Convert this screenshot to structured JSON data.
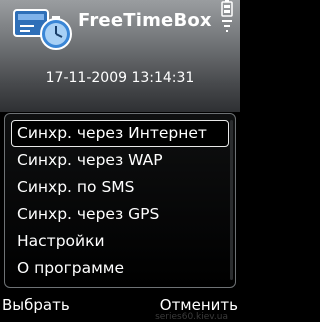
{
  "app": {
    "title": "FreeTimeBox",
    "datetime": "17-11-2009 13:14:31"
  },
  "menu": {
    "items": [
      {
        "label": "Синхр. через Интернет",
        "selected": true
      },
      {
        "label": "Синхр. через WAP",
        "selected": false
      },
      {
        "label": "Синхр. по SMS",
        "selected": false
      },
      {
        "label": "Синхр. через GPS",
        "selected": false
      },
      {
        "label": "Настройки",
        "selected": false
      },
      {
        "label": "О программе",
        "selected": false
      }
    ]
  },
  "softkeys": {
    "left": "Выбрать",
    "right": "Отменить"
  },
  "watermark": "series60.kiev.ua",
  "icons": [
    "app-calendar-clock-icon",
    "battery-icon",
    "signal-icon"
  ],
  "colors": {
    "header_top": "#9a9da0",
    "header_bottom": "#2e3033",
    "menu_border": "#6e7275",
    "text": "#ffffff",
    "background": "#000000"
  }
}
